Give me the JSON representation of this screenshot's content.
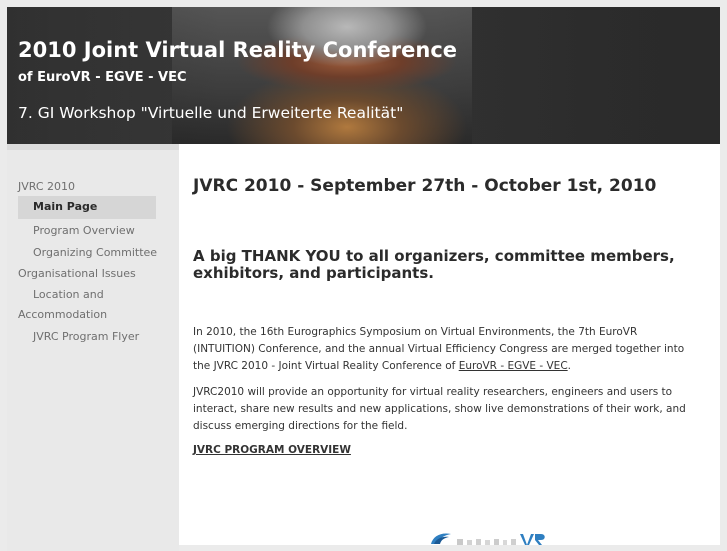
{
  "header": {
    "title": "2010 Joint Virtual Reality Conference",
    "subtitle": "of EuroVR - EGVE - VEC",
    "workshop": "7. GI Workshop \"Virtuelle und Erweiterte Realität\""
  },
  "sidebar": {
    "items": [
      {
        "label": "JVRC 2010"
      },
      {
        "label": "Main Page",
        "active": true
      },
      {
        "label": "Program Overview"
      },
      {
        "label": "Organizing Committee"
      },
      {
        "label": "Organisational Issues"
      },
      {
        "label": "Location and"
      },
      {
        "label": "Accommodation"
      },
      {
        "label": "JVRC Program Flyer"
      }
    ]
  },
  "main": {
    "title": "JVRC 2010 - September 27th -  October 1st, 2010",
    "thanks": "A big THANK YOU to all organizers, committee members, exhibitors, and participants.",
    "p1_text": "In 2010, the 16th Eurographics Symposium on Virtual Environments, the 7th EuroVR (INTUITION) Conference, and the annual Virtual Efficiency Congress are merged together into the JVRC 2010 - Joint Virtual Reality Conference of ",
    "p1_link": "EuroVR - EGVE - VEC",
    "p1_end": ".",
    "p2": "JVRC2010 will provide an opportunity for virtual reality researchers, engineers and users to interact, share new results and new applications, show live demonstrations of their work, and discuss emerging directions for the field.",
    "program_link": "JVRC PROGRAM OVERVIEW"
  },
  "colors": {
    "header_bg": "#343434",
    "page_bg": "#ebebeb",
    "active_nav_bg": "#d6d6d6",
    "logo_blue": "#2f7fc1"
  }
}
